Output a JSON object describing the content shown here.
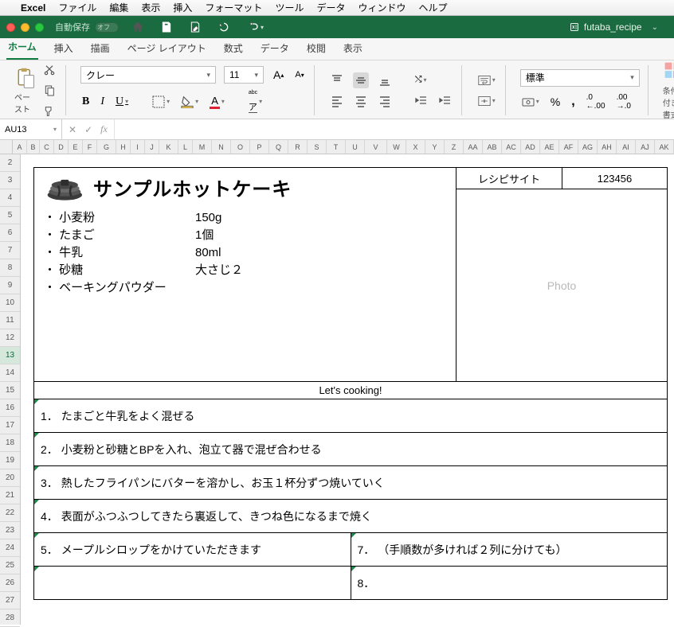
{
  "mac_menu": {
    "apple": "",
    "app": "Excel",
    "items": [
      "ファイル",
      "編集",
      "表示",
      "挿入",
      "フォーマット",
      "ツール",
      "データ",
      "ウィンドウ",
      "ヘルプ"
    ]
  },
  "titlebar": {
    "autosave_label": "自動保存",
    "autosave_state": "オフ",
    "doc": "futaba_recipe"
  },
  "tabs": [
    "ホーム",
    "挿入",
    "描画",
    "ページ レイアウト",
    "数式",
    "データ",
    "校閲",
    "表示"
  ],
  "ribbon": {
    "paste": "ペースト",
    "font_name": "クレー",
    "font_size": "11",
    "number_format": "標準",
    "cond_format": "条件付き書式"
  },
  "fbar": {
    "cell": "AU13",
    "formula": ""
  },
  "cols": [
    "A",
    "B",
    "C",
    "D",
    "E",
    "F",
    "G",
    "H",
    "I",
    "J",
    "K",
    "L",
    "M",
    "N",
    "O",
    "P",
    "Q",
    "R",
    "S",
    "T",
    "U",
    "V",
    "W",
    "X",
    "Y",
    "Z",
    "AA",
    "AB",
    "AC",
    "AD",
    "AE",
    "AF",
    "AG",
    "AH",
    "AI",
    "AJ",
    "AK"
  ],
  "rows": [
    "2",
    "3",
    "4",
    "5",
    "6",
    "7",
    "8",
    "9",
    "10",
    "11",
    "12",
    "13",
    "14",
    "15",
    "16",
    "17",
    "18",
    "19",
    "20",
    "21",
    "22",
    "23",
    "24",
    "25",
    "26",
    "27",
    "28"
  ],
  "selected_row": "13",
  "recipe": {
    "title": "サンプルホットケーキ",
    "site_label": "レシピサイト",
    "site_id": "123456",
    "photo_placeholder": "Photo",
    "ingredients": [
      {
        "name": "・ 小麦粉",
        "amount": "150g"
      },
      {
        "name": "・ たまご",
        "amount": "1個"
      },
      {
        "name": "・ 牛乳",
        "amount": "80ml"
      },
      {
        "name": "・ 砂糖",
        "amount": "大さじ２"
      },
      {
        "name": "・ ベーキングパウダー",
        "amount": ""
      }
    ],
    "cooking_label": "Let's cooking!",
    "steps": [
      "たまごと牛乳をよく混ぜる",
      "小麦粉と砂糖とBPを入れ、泡立て器で混ぜ合わせる",
      "熱したフライパンにバターを溶かし、お玉１杯分ずつ焼いていく",
      "表面がふつふつしてきたら裏返して、きつね色になるまで焼く",
      "メープルシロップをかけていただきます",
      "",
      "（手順数が多ければ２列に分けても）",
      ""
    ]
  }
}
